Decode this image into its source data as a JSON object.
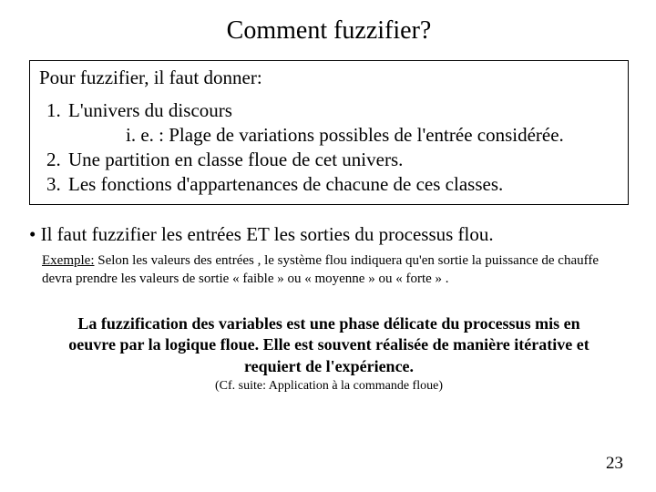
{
  "title": "Comment fuzzifier?",
  "box": {
    "intro": "Pour fuzzifier, il faut donner:",
    "items": [
      {
        "num": "1.",
        "text": "L'univers du discours"
      },
      {
        "sub": "i. e. : Plage de variations possibles de l'entrée considérée."
      },
      {
        "num": "2.",
        "text": "Une partition  en classe floue de cet univers."
      },
      {
        "num": "3.",
        "text": "Les fonctions d'appartenances de chacune de ces classes."
      }
    ]
  },
  "bullet": "• Il faut fuzzifier les entrées ET les sorties du processus flou.",
  "example": {
    "label": "Exemple:",
    "text": "   Selon les valeurs des entrées , le système flou indiquera qu'en  sortie la puissance de chauffe devra  prendre les valeurs de sortie « faible » ou « moyenne » ou « forte » ."
  },
  "conclusion": "La fuzzification des variables est une phase délicate du processus mis en oeuvre par la logique floue. Elle est souvent réalisée de manière itérative et requiert de l'expérience.",
  "cf": "(Cf. suite: Application à la commande floue)",
  "page": "23"
}
